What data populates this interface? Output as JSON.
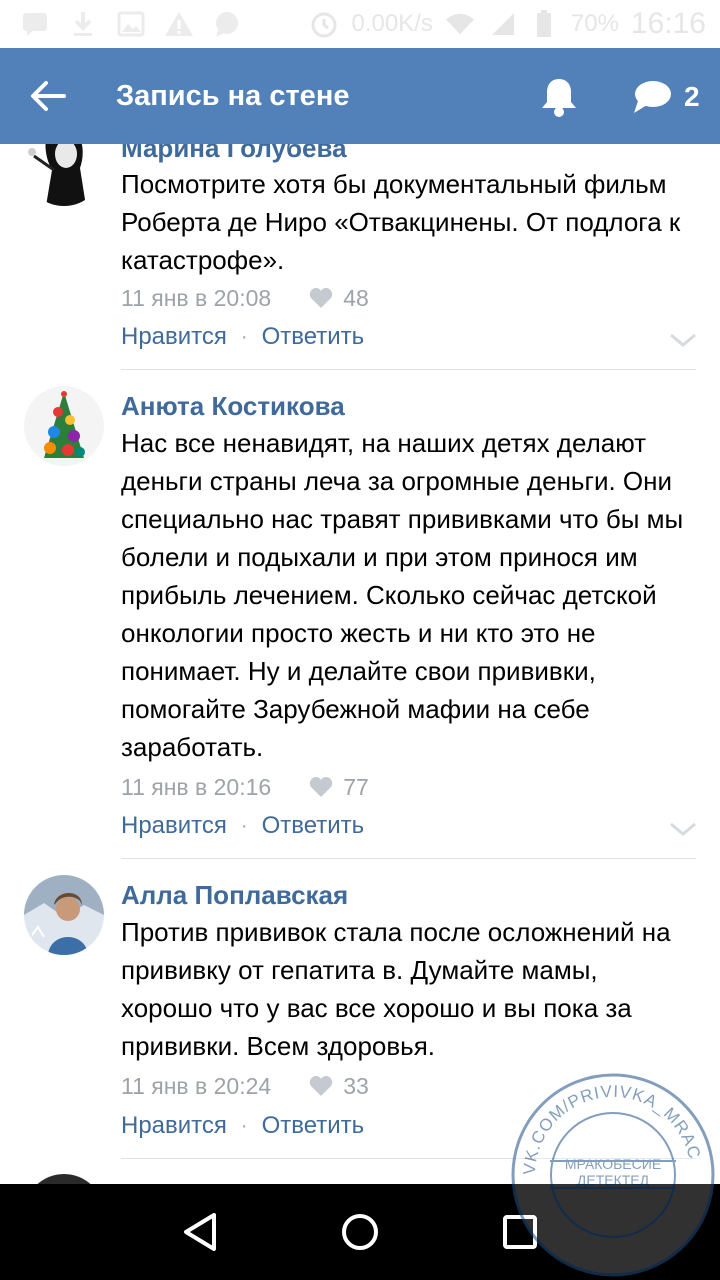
{
  "status_bar": {
    "net_speed": "0.00K/s",
    "battery_pct": "70%",
    "time": "16:16",
    "icons": [
      "message-icon",
      "download-icon",
      "image-icon",
      "warning-icon",
      "chat-icon",
      "alarm-icon",
      "wifi-icon",
      "signal-icon",
      "battery-icon"
    ]
  },
  "header": {
    "title": "Запись на стене",
    "back_icon": "arrow-left-icon",
    "bell_icon": "bell-icon",
    "comments_icon": "speech-bubble-icon",
    "comments_count": "2",
    "background": "#5181b8"
  },
  "comments": [
    {
      "author": "Марина Голубева",
      "text": "Посмотрите хотя бы документальный фильм Роберта де Ниро «Отвакцинены. От подлога к катастрофе».",
      "time": "11 янв в 20:08",
      "likes": "48",
      "like_label": "Нравится",
      "reply_label": "Ответить"
    },
    {
      "author": "Анюта Костикова",
      "text": "Нас все ненавидят, на наших детях делают деньги страны леча за огромные деньги. Они специально нас травят прививками что бы мы болели и подыхали и при этом принося им прибыль лечением. Сколько сейчас детской онкологии просто жесть и ни кто это не понимает. Ну и делайте свои прививки, помогайте Зарубежной мафии на себе заработать.",
      "time": "11 янв в 20:16",
      "likes": "77",
      "like_label": "Нравится",
      "reply_label": "Ответить"
    },
    {
      "author": "Алла Поплавская",
      "text": "Против прививок стала после осложнений на прививку от гепатита в. Думайте мамы, хорошо что у вас все хорошо и вы пока за прививки. Всем здоровья.",
      "time": "11 янв в 20:24",
      "likes": "33",
      "like_label": "Нравится",
      "reply_label": "Ответить"
    }
  ],
  "watermark": {
    "ring_text": "VK.COM/PRIVIVKA_MRAC",
    "line1": "МРАКОБЕСИЕ",
    "line2": "ДЕТЕКТЕД"
  },
  "colors": {
    "link": "#3f6a9a",
    "meta": "#9ea3a9",
    "header": "#5181b8"
  }
}
